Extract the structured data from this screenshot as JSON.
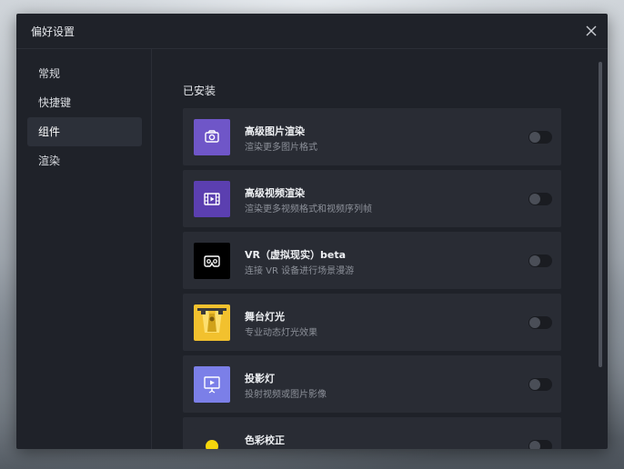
{
  "dialog": {
    "title": "偏好设置",
    "close_icon": "close-icon"
  },
  "sidebar": {
    "items": [
      {
        "label": "常规",
        "active": false
      },
      {
        "label": "快捷键",
        "active": false
      },
      {
        "label": "组件",
        "active": true
      },
      {
        "label": "渲染",
        "active": false
      }
    ]
  },
  "main": {
    "section_title": "已安装",
    "plugins": [
      {
        "name": "高级图片渲染",
        "desc": "渲染更多图片格式",
        "icon": "camera-icon",
        "icon_bg": "#6f56c8",
        "enabled": false
      },
      {
        "name": "高级视频渲染",
        "desc": "渲染更多视频格式和视频序列帧",
        "icon": "film-icon",
        "icon_bg": "#5b3fb0",
        "enabled": false
      },
      {
        "name": "VR（虚拟现实）beta",
        "desc": "连接 VR 设备进行场景漫游",
        "icon": "vr-headset-icon",
        "icon_bg": "#000000",
        "enabled": false
      },
      {
        "name": "舞台灯光",
        "desc": "专业动态灯光效果",
        "icon": "stage-light-icon",
        "icon_bg": "#f2c12e",
        "enabled": false
      },
      {
        "name": "投影灯",
        "desc": "投射视频或图片影像",
        "icon": "projector-icon",
        "icon_bg": "#7b7fe8",
        "enabled": false
      },
      {
        "name": "色彩校正",
        "desc": "",
        "icon": "color-balls-icon",
        "icon_bg": "#292c34",
        "enabled": false
      }
    ]
  }
}
